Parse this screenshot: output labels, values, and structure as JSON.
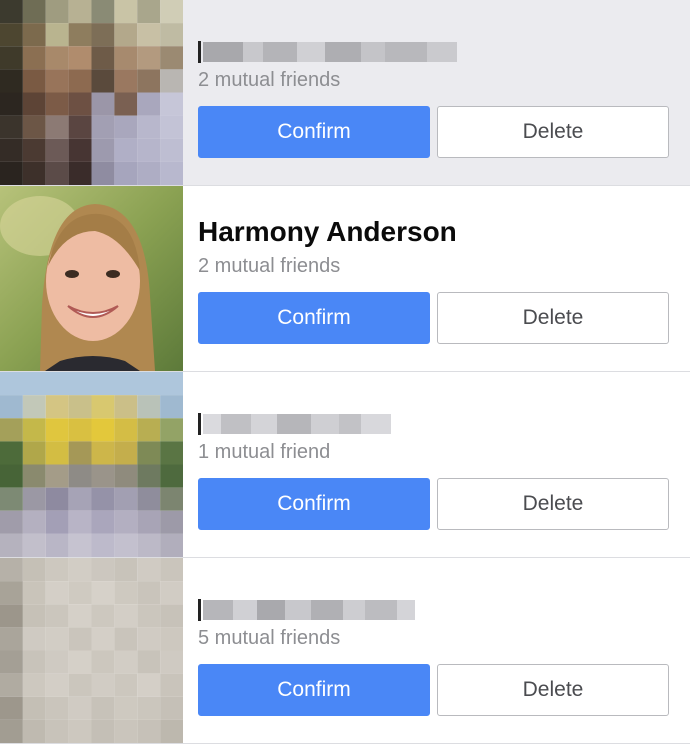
{
  "requests": [
    {
      "name_visible": false,
      "mutual": "2 mutual friends",
      "confirm_label": "Confirm",
      "delete_label": "Delete",
      "avatar": "pixelated-photo"
    },
    {
      "name_visible": true,
      "name": "Harmony Anderson",
      "mutual": "2 mutual friends",
      "confirm_label": "Confirm",
      "delete_label": "Delete",
      "avatar": "portrait-photo"
    },
    {
      "name_visible": false,
      "mutual": "1 mutual friend",
      "confirm_label": "Confirm",
      "delete_label": "Delete",
      "avatar": "pixelated-photo"
    },
    {
      "name_visible": false,
      "mutual": "5 mutual friends",
      "confirm_label": "Confirm",
      "delete_label": "Delete",
      "avatar": "pixelated-photo"
    }
  ],
  "colors": {
    "confirm_bg": "#4a87f6",
    "first_row_bg": "#ebebef",
    "mutual_text": "#8d8e92"
  }
}
